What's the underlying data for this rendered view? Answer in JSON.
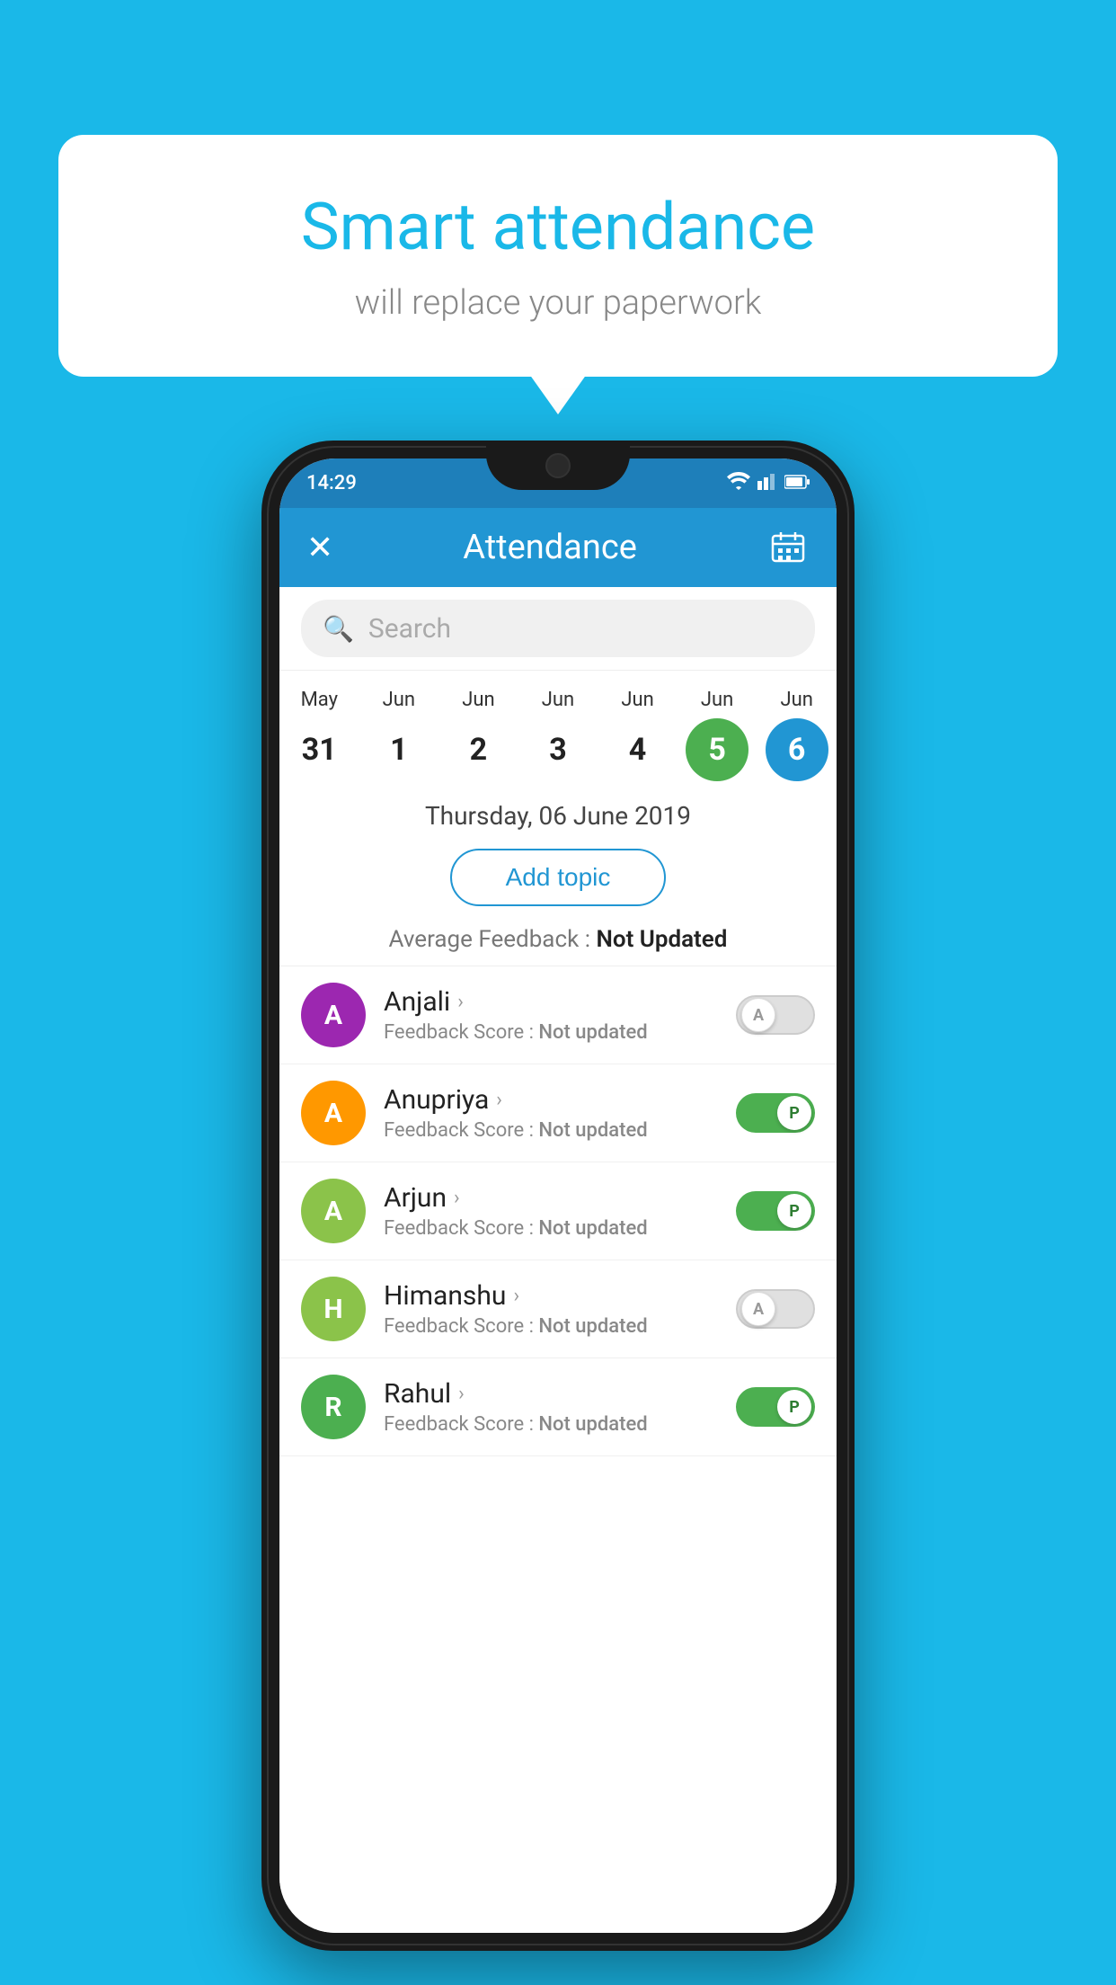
{
  "background_color": "#1ab8e8",
  "bubble": {
    "title": "Smart attendance",
    "subtitle": "will replace your paperwork"
  },
  "phone": {
    "status_bar": {
      "time": "14:29",
      "wifi": "▼▲",
      "signal": "▲",
      "battery": "▮"
    },
    "header": {
      "title": "Attendance",
      "close_icon": "✕",
      "calendar_icon": "📅"
    },
    "search": {
      "placeholder": "Search"
    },
    "calendar": {
      "dates": [
        {
          "month": "May",
          "day": "31",
          "state": "normal"
        },
        {
          "month": "Jun",
          "day": "1",
          "state": "normal"
        },
        {
          "month": "Jun",
          "day": "2",
          "state": "normal"
        },
        {
          "month": "Jun",
          "day": "3",
          "state": "normal"
        },
        {
          "month": "Jun",
          "day": "4",
          "state": "normal"
        },
        {
          "month": "Jun",
          "day": "5",
          "state": "today"
        },
        {
          "month": "Jun",
          "day": "6",
          "state": "selected"
        }
      ]
    },
    "selected_date": "Thursday, 06 June 2019",
    "add_topic_button": "Add topic",
    "feedback_label": "Average Feedback :",
    "feedback_value": "Not Updated",
    "students": [
      {
        "name": "Anjali",
        "avatar_letter": "A",
        "avatar_color": "#9c27b0",
        "feedback_label": "Feedback Score :",
        "feedback_value": "Not updated",
        "attendance": "absent",
        "toggle_label": "A"
      },
      {
        "name": "Anupriya",
        "avatar_letter": "A",
        "avatar_color": "#ff9800",
        "feedback_label": "Feedback Score :",
        "feedback_value": "Not updated",
        "attendance": "present",
        "toggle_label": "P"
      },
      {
        "name": "Arjun",
        "avatar_letter": "A",
        "avatar_color": "#8bc34a",
        "feedback_label": "Feedback Score :",
        "feedback_value": "Not updated",
        "attendance": "present",
        "toggle_label": "P"
      },
      {
        "name": "Himanshu",
        "avatar_letter": "H",
        "avatar_color": "#8bc34a",
        "feedback_label": "Feedback Score :",
        "feedback_value": "Not updated",
        "attendance": "absent",
        "toggle_label": "A"
      },
      {
        "name": "Rahul",
        "avatar_letter": "R",
        "avatar_color": "#4caf50",
        "feedback_label": "Feedback Score :",
        "feedback_value": "Not updated",
        "attendance": "present",
        "toggle_label": "P"
      }
    ]
  }
}
